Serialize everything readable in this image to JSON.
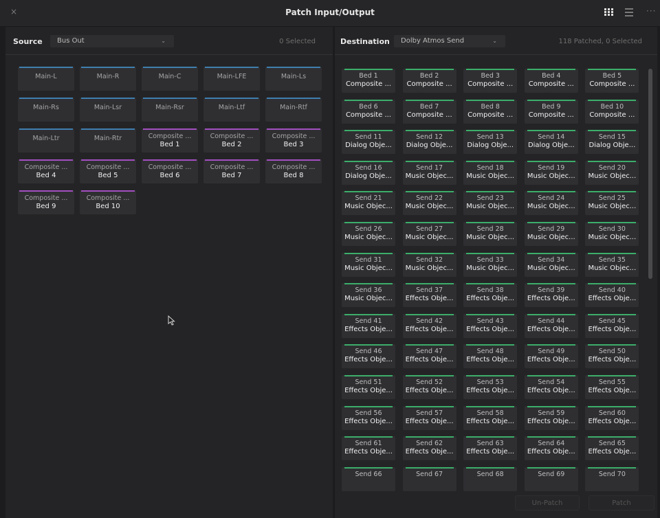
{
  "window": {
    "title": "Patch Input/Output",
    "close_glyph": "×",
    "more_glyph": "···"
  },
  "source": {
    "label": "Source",
    "dropdown_value": "Bus Out",
    "selected_count": "0 Selected",
    "tiles": [
      {
        "type": "bus",
        "l1": "Main-L",
        "l2": ""
      },
      {
        "type": "bus",
        "l1": "Main-R",
        "l2": ""
      },
      {
        "type": "bus",
        "l1": "Main-C",
        "l2": ""
      },
      {
        "type": "bus",
        "l1": "Main-LFE",
        "l2": ""
      },
      {
        "type": "bus",
        "l1": "Main-Ls",
        "l2": ""
      },
      {
        "type": "bus",
        "l1": "Main-Rs",
        "l2": ""
      },
      {
        "type": "bus",
        "l1": "Main-Lsr",
        "l2": ""
      },
      {
        "type": "bus",
        "l1": "Main-Rsr",
        "l2": ""
      },
      {
        "type": "bus",
        "l1": "Main-Ltf",
        "l2": ""
      },
      {
        "type": "bus",
        "l1": "Main-Rtf",
        "l2": ""
      },
      {
        "type": "bus",
        "l1": "Main-Ltr",
        "l2": ""
      },
      {
        "type": "bus",
        "l1": "Main-Rtr",
        "l2": ""
      },
      {
        "type": "comp",
        "l1": "Composite ...",
        "l2": "Bed 1"
      },
      {
        "type": "comp",
        "l1": "Composite ...",
        "l2": "Bed 2"
      },
      {
        "type": "comp",
        "l1": "Composite ...",
        "l2": "Bed 3"
      },
      {
        "type": "comp",
        "l1": "Composite ...",
        "l2": "Bed 4"
      },
      {
        "type": "comp",
        "l1": "Composite ...",
        "l2": "Bed 5"
      },
      {
        "type": "comp",
        "l1": "Composite ...",
        "l2": "Bed 6"
      },
      {
        "type": "comp",
        "l1": "Composite ...",
        "l2": "Bed 7"
      },
      {
        "type": "comp",
        "l1": "Composite ...",
        "l2": "Bed 8"
      },
      {
        "type": "comp",
        "l1": "Composite ...",
        "l2": "Bed 9"
      },
      {
        "type": "comp",
        "l1": "Composite ...",
        "l2": "Bed 10"
      }
    ]
  },
  "destination": {
    "label": "Destination",
    "dropdown_value": "Dolby Atmos Send",
    "patched_count": "118 Patched, 0 Selected",
    "tiles": [
      {
        "l1": "Bed 1",
        "l2": "Composite ..."
      },
      {
        "l1": "Bed 2",
        "l2": "Composite ..."
      },
      {
        "l1": "Bed 3",
        "l2": "Composite ..."
      },
      {
        "l1": "Bed 4",
        "l2": "Composite ..."
      },
      {
        "l1": "Bed 5",
        "l2": "Composite ..."
      },
      {
        "l1": "Bed 6",
        "l2": "Composite ..."
      },
      {
        "l1": "Bed 7",
        "l2": "Composite ..."
      },
      {
        "l1": "Bed 8",
        "l2": "Composite ..."
      },
      {
        "l1": "Bed 9",
        "l2": "Composite ..."
      },
      {
        "l1": "Bed 10",
        "l2": "Composite ..."
      },
      {
        "l1": "Send 11",
        "l2": "Dialog Obje..."
      },
      {
        "l1": "Send 12",
        "l2": "Dialog Obje..."
      },
      {
        "l1": "Send 13",
        "l2": "Dialog Obje..."
      },
      {
        "l1": "Send 14",
        "l2": "Dialog Obje..."
      },
      {
        "l1": "Send 15",
        "l2": "Dialog Obje..."
      },
      {
        "l1": "Send 16",
        "l2": "Dialog Obje..."
      },
      {
        "l1": "Send 17",
        "l2": "Music Objec..."
      },
      {
        "l1": "Send 18",
        "l2": "Music Objec..."
      },
      {
        "l1": "Send 19",
        "l2": "Music Objec..."
      },
      {
        "l1": "Send 20",
        "l2": "Music Objec..."
      },
      {
        "l1": "Send 21",
        "l2": "Music Objec..."
      },
      {
        "l1": "Send 22",
        "l2": "Music Objec..."
      },
      {
        "l1": "Send 23",
        "l2": "Music Objec..."
      },
      {
        "l1": "Send 24",
        "l2": "Music Objec..."
      },
      {
        "l1": "Send 25",
        "l2": "Music Objec..."
      },
      {
        "l1": "Send 26",
        "l2": "Music Objec..."
      },
      {
        "l1": "Send 27",
        "l2": "Music Objec..."
      },
      {
        "l1": "Send 28",
        "l2": "Music Objec..."
      },
      {
        "l1": "Send 29",
        "l2": "Music Objec..."
      },
      {
        "l1": "Send 30",
        "l2": "Music Objec..."
      },
      {
        "l1": "Send 31",
        "l2": "Music Objec..."
      },
      {
        "l1": "Send 32",
        "l2": "Music Objec..."
      },
      {
        "l1": "Send 33",
        "l2": "Music Objec..."
      },
      {
        "l1": "Send 34",
        "l2": "Music Objec..."
      },
      {
        "l1": "Send 35",
        "l2": "Music Objec..."
      },
      {
        "l1": "Send 36",
        "l2": "Music Objec..."
      },
      {
        "l1": "Send 37",
        "l2": "Effects Obje..."
      },
      {
        "l1": "Send 38",
        "l2": "Effects Obje..."
      },
      {
        "l1": "Send 39",
        "l2": "Effects Obje..."
      },
      {
        "l1": "Send 40",
        "l2": "Effects Obje..."
      },
      {
        "l1": "Send 41",
        "l2": "Effects Obje..."
      },
      {
        "l1": "Send 42",
        "l2": "Effects Obje..."
      },
      {
        "l1": "Send 43",
        "l2": "Effects Obje..."
      },
      {
        "l1": "Send 44",
        "l2": "Effects Obje..."
      },
      {
        "l1": "Send 45",
        "l2": "Effects Obje..."
      },
      {
        "l1": "Send 46",
        "l2": "Effects Obje..."
      },
      {
        "l1": "Send 47",
        "l2": "Effects Obje..."
      },
      {
        "l1": "Send 48",
        "l2": "Effects Obje..."
      },
      {
        "l1": "Send 49",
        "l2": "Effects Obje..."
      },
      {
        "l1": "Send 50",
        "l2": "Effects Obje..."
      },
      {
        "l1": "Send 51",
        "l2": "Effects Obje..."
      },
      {
        "l1": "Send 52",
        "l2": "Effects Obje..."
      },
      {
        "l1": "Send 53",
        "l2": "Effects Obje..."
      },
      {
        "l1": "Send 54",
        "l2": "Effects Obje..."
      },
      {
        "l1": "Send 55",
        "l2": "Effects Obje..."
      },
      {
        "l1": "Send 56",
        "l2": "Effects Obje..."
      },
      {
        "l1": "Send 57",
        "l2": "Effects Obje..."
      },
      {
        "l1": "Send 58",
        "l2": "Effects Obje..."
      },
      {
        "l1": "Send 59",
        "l2": "Effects Obje..."
      },
      {
        "l1": "Send 60",
        "l2": "Effects Obje..."
      },
      {
        "l1": "Send 61",
        "l2": "Effects Obje..."
      },
      {
        "l1": "Send 62",
        "l2": "Effects Obje..."
      },
      {
        "l1": "Send 63",
        "l2": "Effects Obje..."
      },
      {
        "l1": "Send 64",
        "l2": "Effects Obje..."
      },
      {
        "l1": "Send 65",
        "l2": "Effects Obje..."
      },
      {
        "l1": "Send 66",
        "l2": ""
      },
      {
        "l1": "Send 67",
        "l2": ""
      },
      {
        "l1": "Send 68",
        "l2": ""
      },
      {
        "l1": "Send 69",
        "l2": ""
      },
      {
        "l1": "Send 70",
        "l2": ""
      }
    ]
  },
  "buttons": {
    "unpatch": "Un-Patch",
    "patch": "Patch"
  },
  "colors": {
    "bus_bar": "#3f7fb0",
    "composite_bar": "#a34fc0",
    "dest_bar": "#3cae6a"
  },
  "icons": {
    "grid_view": "grid-view-icon",
    "list_view": "list-view-icon",
    "cursor": "mouse-pointer-icon"
  }
}
